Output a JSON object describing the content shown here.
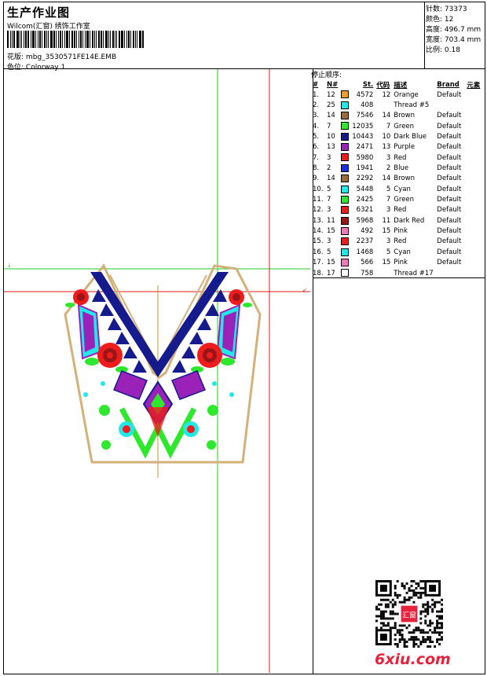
{
  "header": {
    "title": "生产作业图",
    "subtitle": "Wilcom(汇窗) 绣饰工作室",
    "design_label": "花版:",
    "design_file": "mbg_3530571FE14E.EMB",
    "color_label": "色位:",
    "colorway": "Colorway 1"
  },
  "stats": [
    {
      "label": "针数:",
      "value": "73373"
    },
    {
      "label": "颜色:",
      "value": "12"
    },
    {
      "label": "高度:",
      "value": "496.7 mm"
    },
    {
      "label": "宽度:",
      "value": "703.4 mm"
    },
    {
      "label": "比例:",
      "value": "0.18"
    }
  ],
  "threads": {
    "title": "停止顺序:",
    "columns": [
      "#",
      "N#",
      "St.",
      "代码",
      "描述",
      "Brand",
      "元素"
    ],
    "rows": [
      {
        "idx": "1.",
        "n": "12",
        "color": "#f39a2c",
        "st": "4572",
        "code": "12",
        "desc": "Orange",
        "brand": "Default"
      },
      {
        "idx": "2.",
        "n": "25",
        "color": "#22e8e8",
        "st": "408",
        "code": "",
        "desc": "Thread #5",
        "brand": ""
      },
      {
        "idx": "3.",
        "n": "14",
        "color": "#9b6a3a",
        "st": "7546",
        "code": "14",
        "desc": "Brown",
        "brand": "Default"
      },
      {
        "idx": "4.",
        "n": "7",
        "color": "#2ee82e",
        "st": "12035",
        "code": "7",
        "desc": "Green",
        "brand": "Default"
      },
      {
        "idx": "5.",
        "n": "10",
        "color": "#151a8c",
        "st": "10443",
        "code": "10",
        "desc": "Dark Blue",
        "brand": "Default"
      },
      {
        "idx": "6.",
        "n": "13",
        "color": "#9b22b8",
        "st": "2471",
        "code": "13",
        "desc": "Purple",
        "brand": "Default"
      },
      {
        "idx": "7.",
        "n": "3",
        "color": "#ee1c1c",
        "st": "5980",
        "code": "3",
        "desc": "Red",
        "brand": "Default"
      },
      {
        "idx": "8.",
        "n": "2",
        "color": "#1d2ee0",
        "st": "1941",
        "code": "2",
        "desc": "Blue",
        "brand": "Default"
      },
      {
        "idx": "9.",
        "n": "14",
        "color": "#9b6a3a",
        "st": "2292",
        "code": "14",
        "desc": "Brown",
        "brand": "Default"
      },
      {
        "idx": "10.",
        "n": "5",
        "color": "#22e8e8",
        "st": "5448",
        "code": "5",
        "desc": "Cyan",
        "brand": "Default"
      },
      {
        "idx": "11.",
        "n": "7",
        "color": "#2ee82e",
        "st": "2425",
        "code": "7",
        "desc": "Green",
        "brand": "Default"
      },
      {
        "idx": "12.",
        "n": "3",
        "color": "#ee1c1c",
        "st": "6321",
        "code": "3",
        "desc": "Red",
        "brand": "Default"
      },
      {
        "idx": "13.",
        "n": "11",
        "color": "#9a1616",
        "st": "5968",
        "code": "11",
        "desc": "Dark Red",
        "brand": "Default"
      },
      {
        "idx": "14.",
        "n": "15",
        "color": "#f07ab8",
        "st": "492",
        "code": "15",
        "desc": "Pink",
        "brand": "Default"
      },
      {
        "idx": "15.",
        "n": "3",
        "color": "#ee1c1c",
        "st": "2237",
        "code": "3",
        "desc": "Red",
        "brand": "Default"
      },
      {
        "idx": "16.",
        "n": "5",
        "color": "#22e8e8",
        "st": "1468",
        "code": "5",
        "desc": "Cyan",
        "brand": "Default"
      },
      {
        "idx": "17.",
        "n": "15",
        "color": "#f07ab8",
        "st": "566",
        "code": "15",
        "desc": "Pink",
        "brand": "Default"
      },
      {
        "idx": "18.",
        "n": "17",
        "color": "#ffffff",
        "st": "758",
        "code": "",
        "desc": "Thread #17",
        "brand": ""
      }
    ]
  },
  "watermark": "6xiu.com",
  "qr_seal": "汇窗"
}
